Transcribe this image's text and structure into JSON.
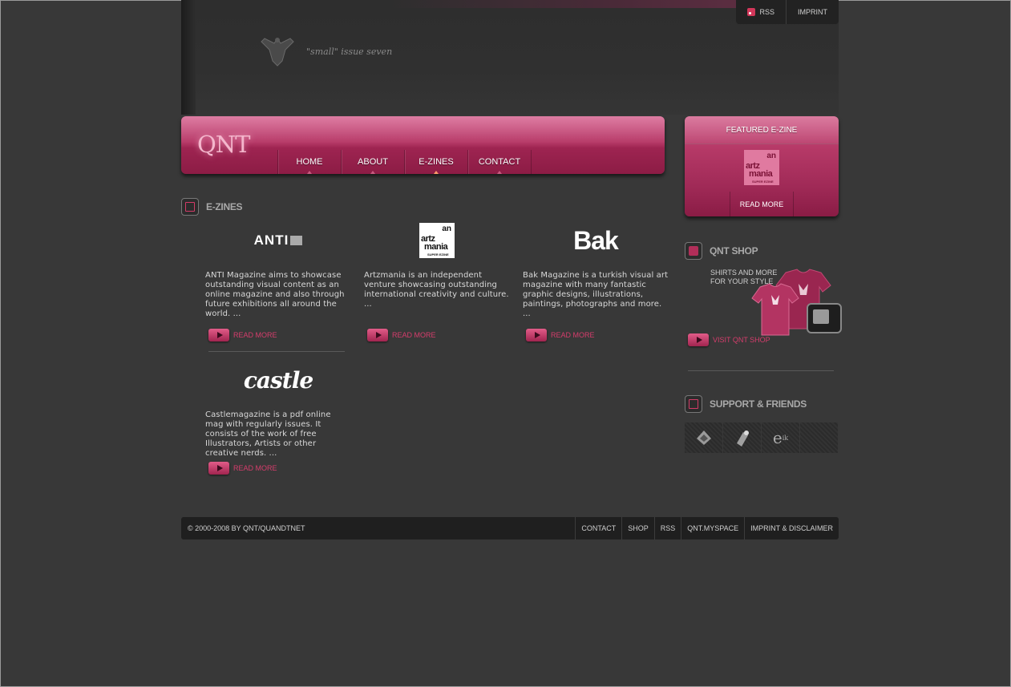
{
  "header": {
    "tagline": "\"small\" issue seven",
    "toplinks": [
      {
        "label": "RSS",
        "icon": "rss-icon"
      },
      {
        "label": "IMPRINT"
      }
    ]
  },
  "nav": {
    "logo": "QNT",
    "items": [
      {
        "label": "HOME"
      },
      {
        "label": "ABOUT"
      },
      {
        "label": "E-ZINES"
      },
      {
        "label": "CONTACT"
      }
    ],
    "active": "E-ZINES"
  },
  "ezines": {
    "title": "E-ZINES",
    "read_more": "READ MORE",
    "items": [
      {
        "logo_text": "ANTI",
        "desc": "ANTI Magazine aims to showcase outstanding visual content as an online magazine and also through future exhibitions all around the world. ..."
      },
      {
        "logo_text": "artz mania",
        "logo_top": "an",
        "logo_small": "SUPER EZINE",
        "desc": "Artzmania is an independent venture showcasing outstanding international creativity and culture. ..."
      },
      {
        "logo_text": "Bak",
        "desc": "Bak Magazine is a turkish visual art magazine with many fantastic graphic designs, illustrations, paintings, photographs and more. ..."
      },
      {
        "logo_text": "castle",
        "desc": "Castlemagazine is a pdf online mag with regularly issues. It consists of the work of free Illustrators, Artists or other creative nerds. ..."
      }
    ]
  },
  "featured": {
    "title": "FEATURED E-ZINE",
    "logo_top": "an",
    "logo_line1": "artz",
    "logo_line2": "mania",
    "logo_small": "SUPER EZINE",
    "read_more": "READ MORE"
  },
  "shop": {
    "title": "QNT SHOP",
    "text_line1": "SHIRTS AND MORE",
    "text_line2": "FOR YOUR STYLE",
    "link": "VISIT QNT SHOP"
  },
  "support": {
    "title": "SUPPORT & FRIENDS",
    "logos": [
      "friend-logo-1",
      "friend-logo-2",
      "friend-logo-3",
      "friend-logo-4"
    ],
    "logo3_text": "e"
  },
  "footer": {
    "copyright": "© 2000-2008 BY QNT/QUANDTNET",
    "links": [
      "CONTACT",
      "SHOP",
      "RSS",
      "QNT.MYSPACE",
      "IMPRINT & DISCLAIMER"
    ]
  },
  "colors": {
    "accent": "#b73a68",
    "link": "#d63d6c",
    "background": "#383838"
  }
}
